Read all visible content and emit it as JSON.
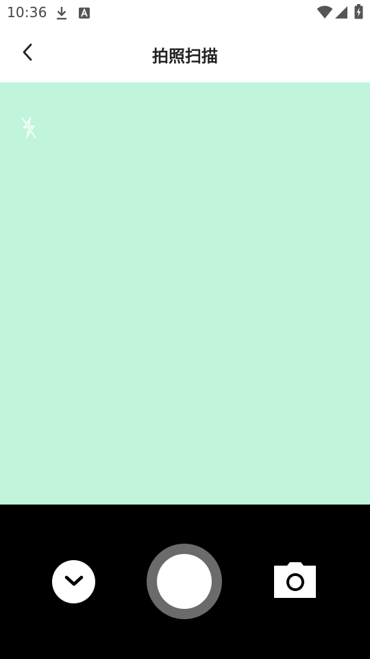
{
  "status_bar": {
    "time": "10:36",
    "icons": [
      "download-icon",
      "text-a-icon",
      "wifi-icon",
      "signal-icon",
      "battery-icon"
    ]
  },
  "app_bar": {
    "title": "拍照扫描",
    "back_icon": "chevron-left-icon"
  },
  "viewfinder": {
    "background_color": "#C0F5DC",
    "flash_icon": "flash-off-icon"
  },
  "controls": {
    "collapse_icon": "chevron-down-icon",
    "shutter_icon": "shutter-icon",
    "switch_icon": "camera-icon"
  },
  "colors": {
    "viewfinder": "#C0F5DC",
    "control_bar": "#000000",
    "shutter_ring": "#6B6B6B"
  }
}
